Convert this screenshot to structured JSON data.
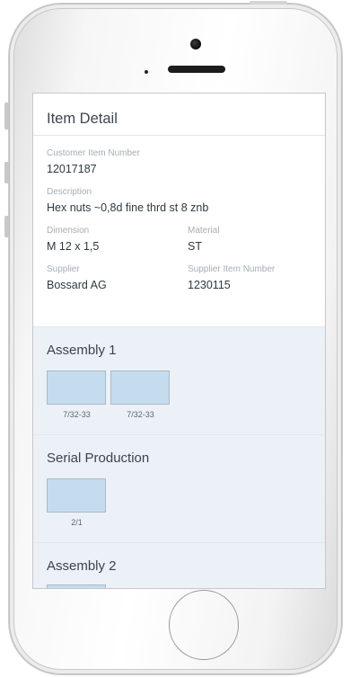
{
  "header": {
    "title": "Item Detail"
  },
  "item": {
    "customer_item_number_label": "Customer Item Number",
    "customer_item_number": "12017187",
    "description_label": "Description",
    "description": "Hex nuts ~0,8d fine thrd st 8 znb",
    "dimension_label": "Dimension",
    "dimension": "M 12 x 1,5",
    "material_label": "Material",
    "material": "ST",
    "supplier_label": "Supplier",
    "supplier": "Bossard AG",
    "supplier_item_number_label": "Supplier Item Number",
    "supplier_item_number": "1230115"
  },
  "sections": [
    {
      "title": "Assembly 1",
      "thumbs": [
        "7/32-33",
        "7/32-33"
      ]
    },
    {
      "title": "Serial Production",
      "thumbs": [
        "2/1"
      ]
    },
    {
      "title": "Assembly 2",
      "thumbs": [
        ""
      ]
    }
  ],
  "colors": {
    "section_bg": "#ecf1f7",
    "thumb_fill": "#c5dcee",
    "text": "#2f3942",
    "label": "#a6adb5"
  }
}
